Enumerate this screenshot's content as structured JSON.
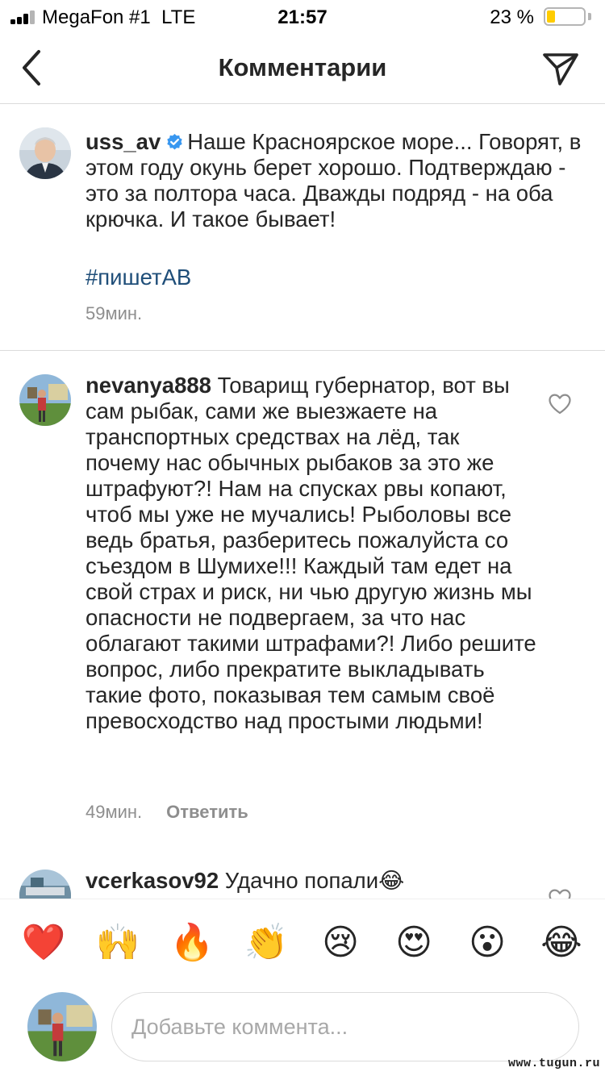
{
  "status_bar": {
    "carrier": "MegaFon #1",
    "network": "LTE",
    "time": "21:57",
    "battery_percent": "23 %",
    "battery_level": 0.23
  },
  "nav": {
    "title": "Комментарии",
    "back_icon": "chevron-left-icon",
    "share_icon": "paper-plane-icon"
  },
  "caption": {
    "username": "uss_av",
    "verified": true,
    "text": "Наше Красноярское море... Говорят, в этом году окунь берет хорошо. Подтверждаю - это за полтора часа. Дважды подряд - на оба крючка. И такое бывает!",
    "hashtag": "#пишетАВ",
    "time": "59мин."
  },
  "comments": [
    {
      "username": "nevanya888",
      "text": "Товарищ губернатор, вот вы сам рыбак, сами же выезжаете на транспортных средствах на лёд, так почему нас обычных рыбаков за это же штрафуют?! Нам на спусках рвы копают, чтоб мы уже не мучались! Рыболовы все ведь братья, разберитесь пожалуйста со съездом в Шумихе!!! Каждый там едет на свой страх и риск, ни чью другую жизнь мы опасности не подвергаем, за что нас облагают такими штрафами?! Либо решите вопрос, либо прекратите выкладывать такие фото, показывая тем самым своё превосходство над простыми людьми!",
      "time": "49мин.",
      "reply_label": "Ответить"
    },
    {
      "username": "vcerkasov92",
      "text": "Удачно попали😂"
    }
  ],
  "emoji_bar": [
    "❤️",
    "🙌",
    "🔥",
    "👏",
    "😢",
    "😍",
    "😮",
    "😂"
  ],
  "composer": {
    "placeholder": "Добавьте коммента..."
  },
  "watermark": "www.tugun.ru",
  "colors": {
    "text": "#262626",
    "secondary": "#8e8e8e",
    "hashtag": "#1f4e79",
    "verified": "#3897f0",
    "battery": "#ffcc00"
  }
}
